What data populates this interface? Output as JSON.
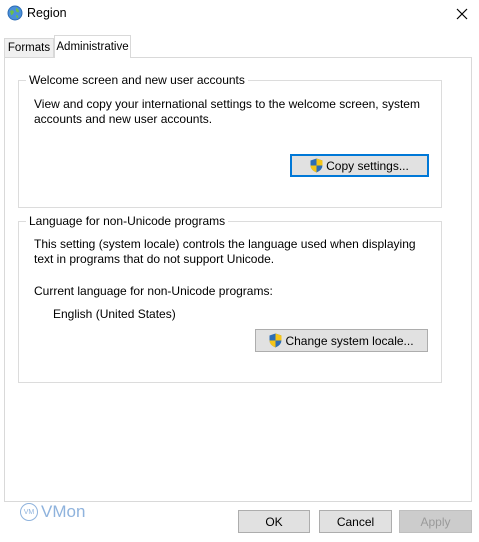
{
  "window": {
    "title": "Region",
    "icon": "globe-icon",
    "close": "close-icon"
  },
  "tabs": [
    {
      "label": "Formats",
      "selected": false
    },
    {
      "label": "Administrative",
      "selected": true
    }
  ],
  "welcome_group": {
    "title": "Welcome screen and new user accounts",
    "description_line1": "View and copy your international settings to the welcome screen, system",
    "description_line2": "accounts and new user accounts.",
    "button_label": "Copy settings...",
    "button_icon": "shield-icon"
  },
  "unicode_group": {
    "title": "Language for non-Unicode programs",
    "description_line1": "This setting (system locale) controls the language used when displaying",
    "description_line2": "text in programs that do not support Unicode.",
    "current_label": "Current language for non-Unicode programs:",
    "current_value": "English (United States)",
    "button_label": "Change system locale...",
    "button_icon": "shield-icon"
  },
  "footer": {
    "ok_label": "OK",
    "cancel_label": "Cancel",
    "apply_label": "Apply",
    "apply_enabled": false
  },
  "watermark": {
    "text": "VMon",
    "badge": "VM"
  },
  "colors": {
    "focus_border": "#0078d7",
    "button_bg": "#e1e1e1",
    "watermark": "#8fb3dd"
  }
}
